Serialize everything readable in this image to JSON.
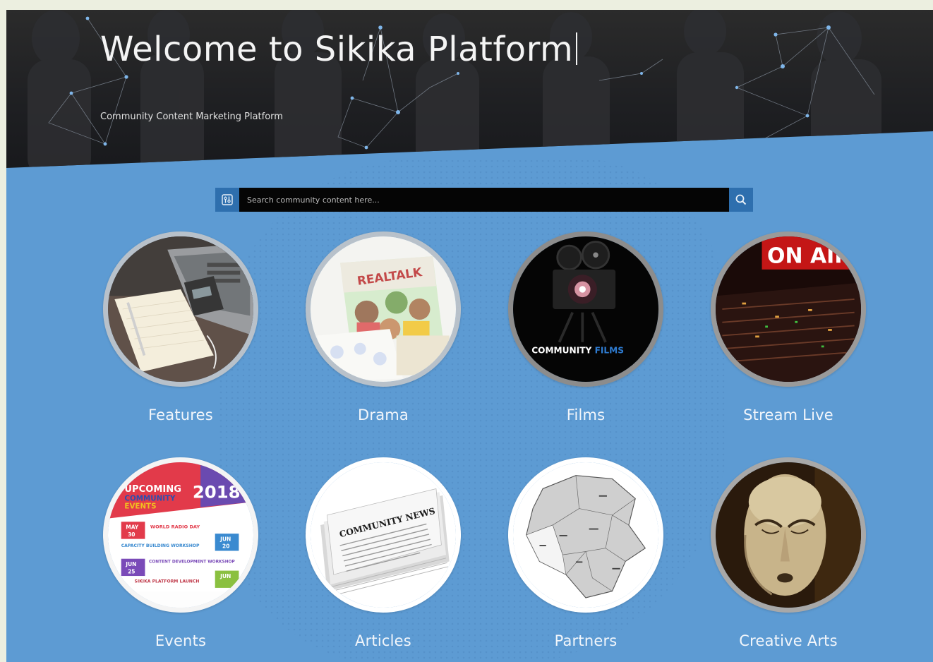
{
  "hero": {
    "title": "Welcome to Sikika Platform",
    "subtitle": "Community Content Marketing Platform"
  },
  "search": {
    "placeholder": "Search community content here...",
    "filter_icon": "filter-icon",
    "search_icon": "search-icon"
  },
  "colors": {
    "page_background": "#5d9bd3",
    "hero_background": "#1e1f22",
    "accent": "#2e6fae",
    "search_field": "#050505",
    "label_text": "#f2f6fb"
  },
  "categories": [
    {
      "label": "Features",
      "image_text": ""
    },
    {
      "label": "Drama",
      "image_text": "REALTALK"
    },
    {
      "label": "Films",
      "image_text_a": "COMMUNITY",
      "image_text_b": "FILMS"
    },
    {
      "label": "Stream Live",
      "image_text": "ON AIR"
    },
    {
      "label": "Events",
      "image_title_a": "UPCOMING",
      "image_title_b": "COMMUNITY",
      "image_title_c": "EVENTS",
      "image_year": "2018",
      "rows": [
        {
          "month": "MAY",
          "day": "30",
          "text": "WORLD RADIO DAY"
        },
        {
          "month": "JUN",
          "day": "20",
          "text": "CAPACITY BUILDING WORKSHOP"
        },
        {
          "month": "JUN",
          "day": "25",
          "text": "CONTENT DEVELOPMENT WORKSHOP"
        },
        {
          "month": "JUN",
          "day": "",
          "text": "SIKIKA PLATFORM LAUNCH"
        }
      ]
    },
    {
      "label": "Articles",
      "image_text": "COMMUNITY NEWS"
    },
    {
      "label": "Partners",
      "image_text": ""
    },
    {
      "label": "Creative Arts",
      "image_text": ""
    }
  ]
}
